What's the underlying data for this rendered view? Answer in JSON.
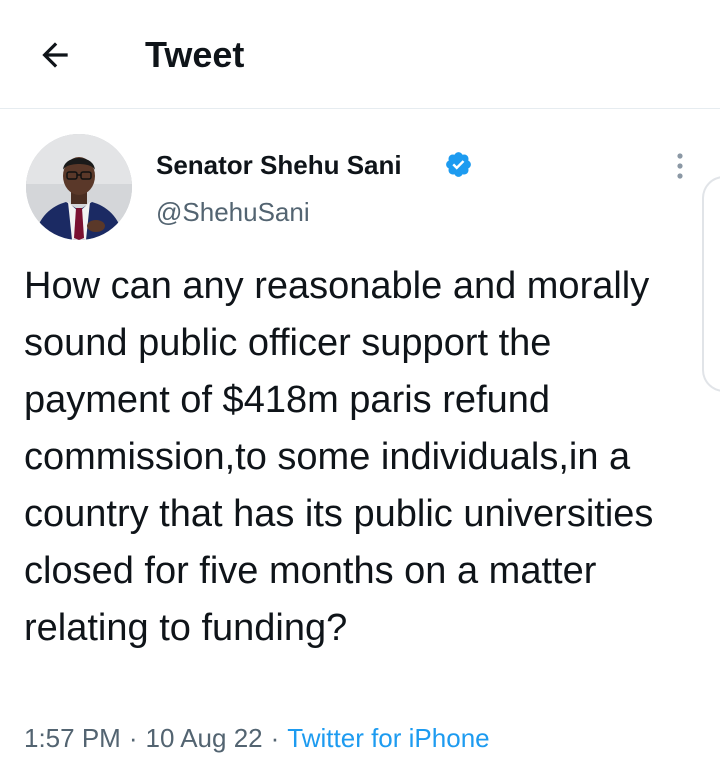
{
  "header": {
    "title": "Tweet"
  },
  "tweet": {
    "author_name": "Senator Shehu Sani",
    "handle": "@ShehuSani",
    "verified": true,
    "text": "How can any reasonable and morally sound public officer support the payment of $418m paris refund commission,to some individuals,in a country that has its public universities closed for five months on a matter relating to funding?",
    "time": "1:57 PM",
    "date": "10 Aug 22",
    "source": "Twitter for iPhone",
    "separator": "·"
  },
  "icons": {
    "back": "back-arrow-icon",
    "verified": "verified-badge-icon",
    "more": "more-vertical-icon"
  },
  "colors": {
    "text": "#0f1419",
    "secondary": "#536471",
    "link": "#1d9bf0",
    "verified": "#1d9bf0",
    "divider": "#e6ecf0"
  }
}
